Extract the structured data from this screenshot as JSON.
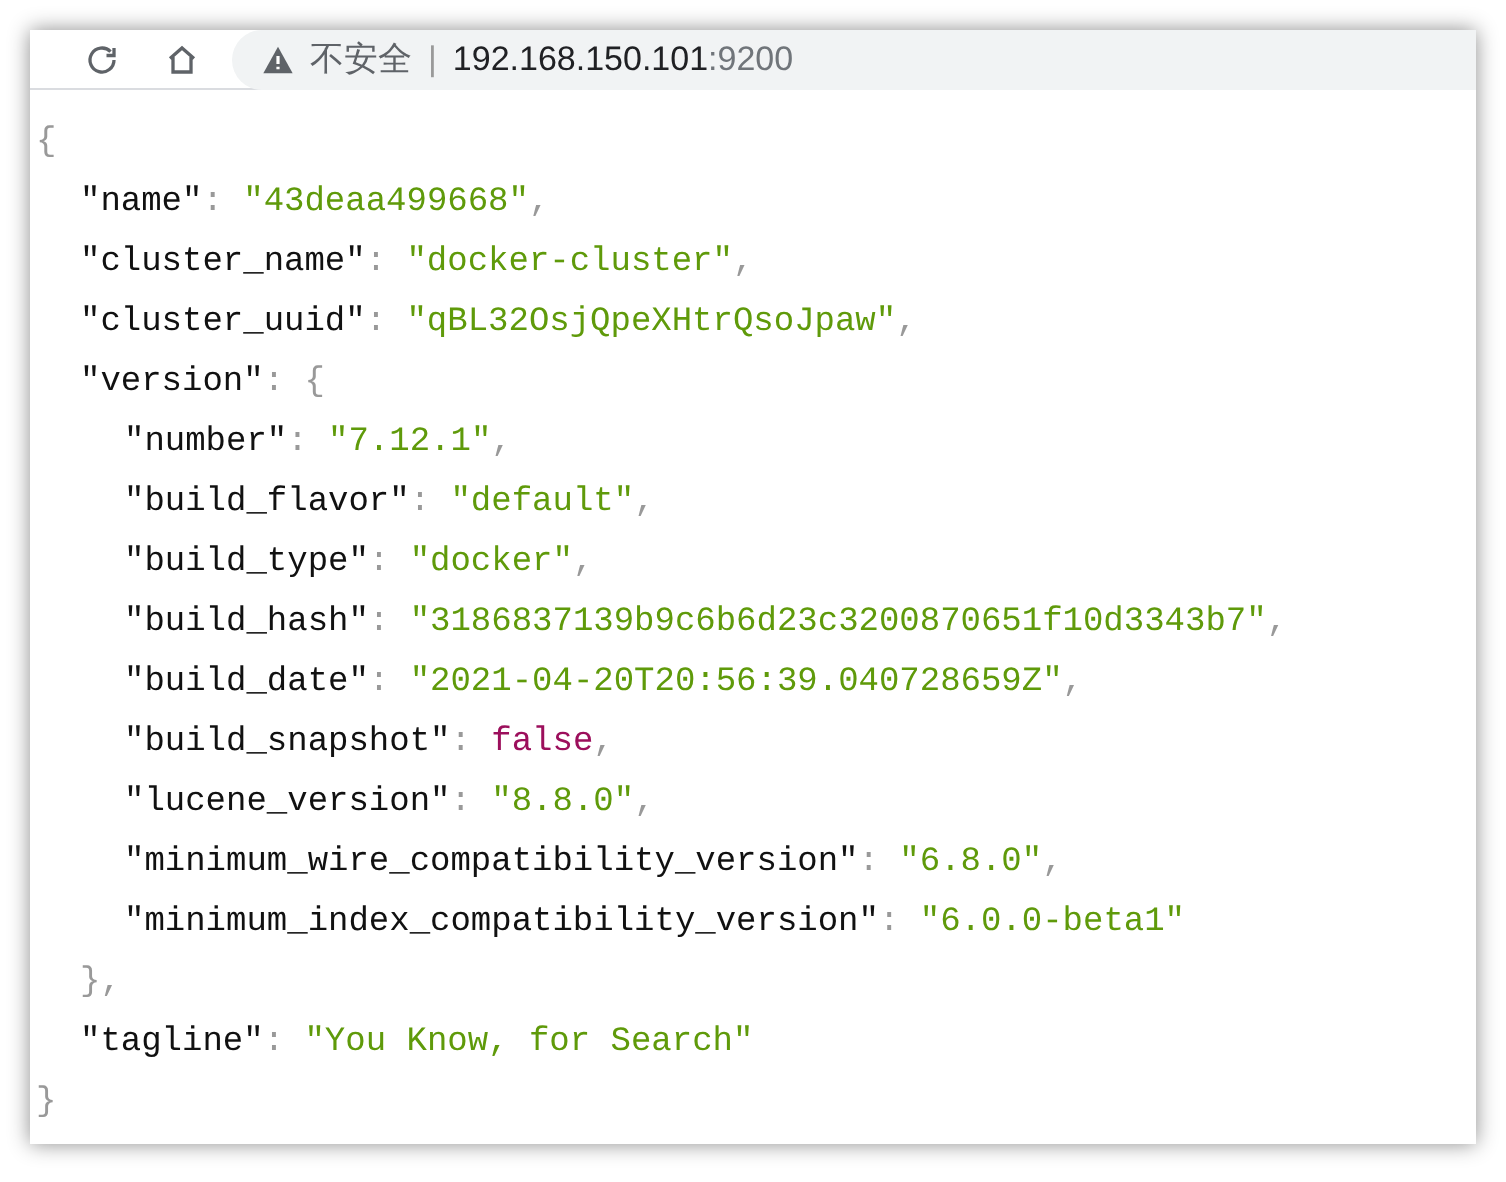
{
  "toolbar": {
    "security_warning": "不安全",
    "separator": "|",
    "url_host": "192.168.150.101",
    "url_port": ":9200"
  },
  "json_view": {
    "open": "{",
    "close": "}",
    "entries": [
      {
        "kind": "string",
        "key": "\"name\"",
        "colon": ":",
        "value": "\"43deaa499668\"",
        "comma": ","
      },
      {
        "kind": "string",
        "key": "\"cluster_name\"",
        "colon": ":",
        "value": "\"docker-cluster\"",
        "comma": ","
      },
      {
        "kind": "string",
        "key": "\"cluster_uuid\"",
        "colon": ":",
        "value": "\"qBL32OsjQpeXHtrQsoJpaw\"",
        "comma": ","
      },
      {
        "kind": "object",
        "key": "\"version\"",
        "colon": ":",
        "open": "{",
        "close": "}",
        "comma": ",",
        "children": [
          {
            "kind": "string",
            "key": "\"number\"",
            "colon": ":",
            "value": "\"7.12.1\"",
            "comma": ","
          },
          {
            "kind": "string",
            "key": "\"build_flavor\"",
            "colon": ":",
            "value": "\"default\"",
            "comma": ","
          },
          {
            "kind": "string",
            "key": "\"build_type\"",
            "colon": ":",
            "value": "\"docker\"",
            "comma": ","
          },
          {
            "kind": "string",
            "key": "\"build_hash\"",
            "colon": ":",
            "value": "\"3186837139b9c6b6d23c3200870651f10d3343b7\"",
            "comma": ","
          },
          {
            "kind": "string",
            "key": "\"build_date\"",
            "colon": ":",
            "value": "\"2021-04-20T20:56:39.040728659Z\"",
            "comma": ","
          },
          {
            "kind": "boolean",
            "key": "\"build_snapshot\"",
            "colon": ":",
            "value": "false",
            "comma": ","
          },
          {
            "kind": "string",
            "key": "\"lucene_version\"",
            "colon": ":",
            "value": "\"8.8.0\"",
            "comma": ","
          },
          {
            "kind": "string",
            "key": "\"minimum_wire_compatibility_version\"",
            "colon": ":",
            "value": "\"6.8.0\"",
            "comma": ","
          },
          {
            "kind": "string",
            "key": "\"minimum_index_compatibility_version\"",
            "colon": ":",
            "value": "\"6.0.0-beta1\""
          }
        ]
      },
      {
        "kind": "string",
        "key": "\"tagline\"",
        "colon": ":",
        "value": "\"You Know, for Search\""
      }
    ]
  }
}
